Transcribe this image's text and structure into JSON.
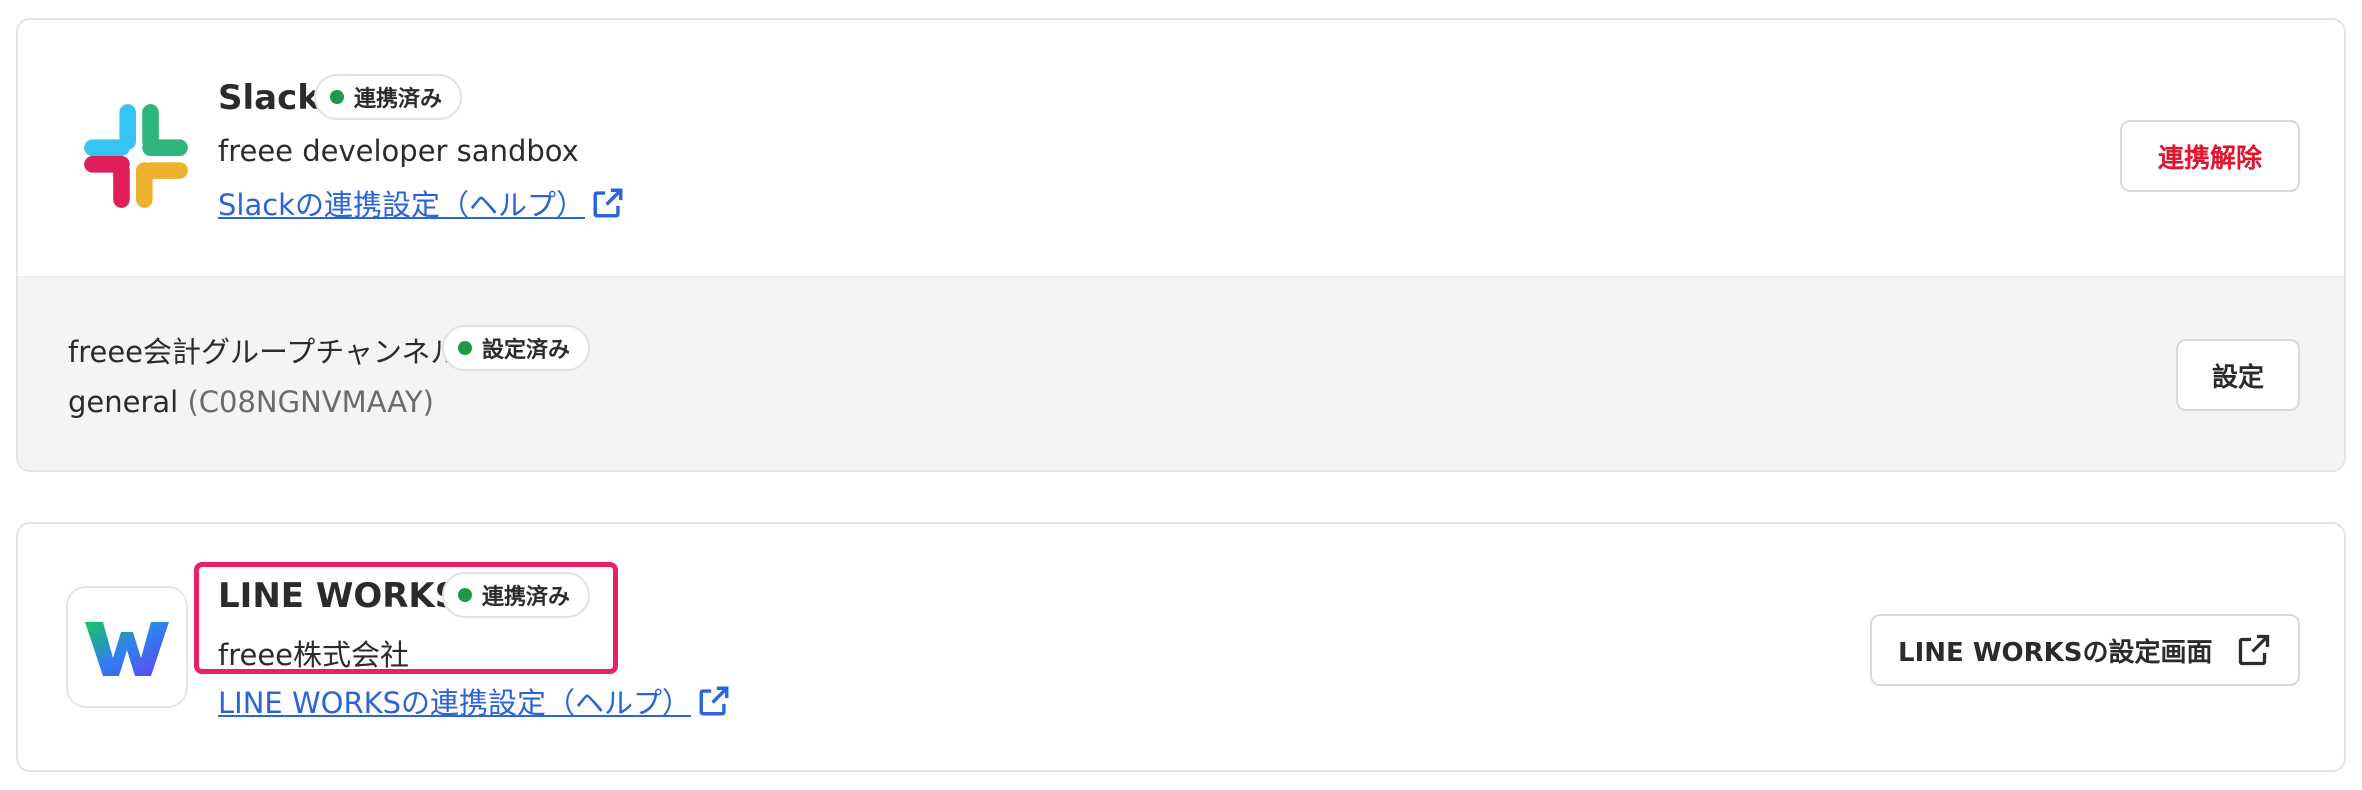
{
  "slack": {
    "name": "Slack",
    "status_badge": "連携済み",
    "workspace": "freee developer sandbox",
    "help_link": "Slackの連携設定（ヘルプ）",
    "disconnect_button": "連携解除",
    "channel": {
      "label": "freee会計グループチャンネル",
      "status_badge": "設定済み",
      "name": "general",
      "id": "(C08NGNVMAAY)",
      "settings_button": "設定"
    }
  },
  "lineworks": {
    "name": "LINE WORKS",
    "status_badge": "連携済み",
    "company": "freee株式会社",
    "help_link": "LINE WORKSの連携設定（ヘルプ）",
    "settings_button": "LINE WORKSの設定画面"
  },
  "colors": {
    "status_dot": "#1a9a4a",
    "link": "#2a64d8",
    "danger": "#e0142c",
    "highlight": "#ea1f64"
  }
}
